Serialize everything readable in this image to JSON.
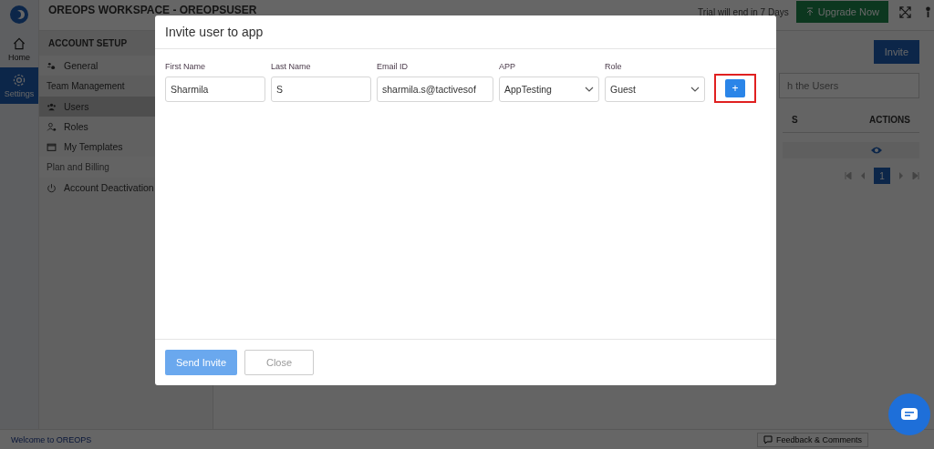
{
  "rail": [
    {
      "label": "Home",
      "selected": false
    },
    {
      "label": "Settings",
      "selected": true
    }
  ],
  "topbar": {
    "title": "OREOPS WORKSPACE - OREOPSUSER",
    "trial": "Trial will end in 7 Days",
    "upgrade": "Upgrade Now"
  },
  "sidebar": {
    "items": [
      {
        "kind": "header",
        "label": "ACCOUNT SETUP"
      },
      {
        "kind": "item",
        "label": "General",
        "selected": false
      },
      {
        "kind": "section",
        "label": "Team Management",
        "disabled": false
      },
      {
        "kind": "item",
        "label": "Users",
        "selected": true
      },
      {
        "kind": "item",
        "label": "Roles",
        "selected": false
      },
      {
        "kind": "item",
        "label": "My Templates",
        "selected": false
      },
      {
        "kind": "section",
        "label": "Plan and Billing",
        "disabled": true
      },
      {
        "kind": "item",
        "label": "Account Deactivation",
        "selected": false
      }
    ]
  },
  "main": {
    "invite_button": "Invite",
    "search": {
      "placeholder": "h the Users"
    },
    "table": {
      "columns": [
        "S",
        "ACTIONS"
      ]
    },
    "pagination": [
      {
        "label": "1",
        "selected": true
      }
    ]
  },
  "modal": {
    "title": "Invite user to app",
    "fields": [
      {
        "kind": "text",
        "label": "First Name",
        "value": "Sharmila"
      },
      {
        "kind": "text",
        "label": "Last Name",
        "value": "S"
      },
      {
        "kind": "text",
        "label": "Email ID",
        "value": "sharmila.s@tactivesof"
      },
      {
        "kind": "select",
        "label": "APP",
        "value": "AppTesting"
      },
      {
        "kind": "select",
        "label": "Role",
        "value": "Guest"
      }
    ],
    "add_button": {
      "label": "+",
      "highlighted": true
    },
    "buttons": [
      {
        "kind": "primary",
        "label": "Send Invite"
      },
      {
        "kind": "secondary",
        "label": "Close"
      }
    ]
  },
  "footer": {
    "welcome": "Welcome to OREOPS",
    "feedback": "Feedback & Comments"
  }
}
